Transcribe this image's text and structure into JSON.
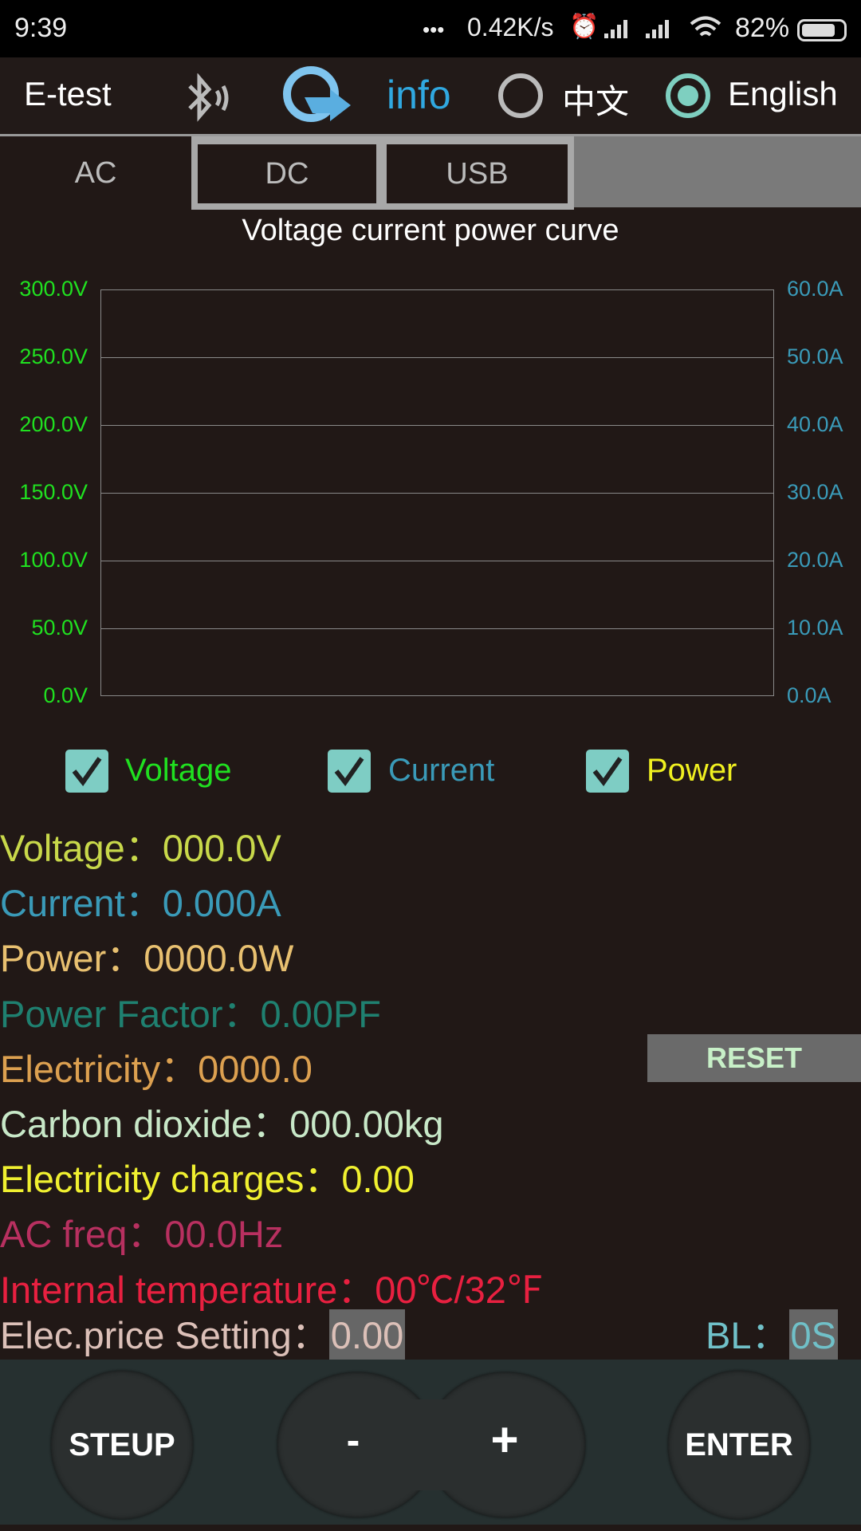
{
  "status_bar": {
    "time": "9:39",
    "dots": "•••",
    "net_speed": "0.42K/s",
    "battery": "82%"
  },
  "header": {
    "app_name": "E-test",
    "info_label": "info",
    "lang_chinese": "中文",
    "lang_english": "English",
    "selected_language": "English"
  },
  "tabs": [
    {
      "label": "AC",
      "active": true
    },
    {
      "label": "DC",
      "active": false
    },
    {
      "label": "USB",
      "active": false
    }
  ],
  "chart_data": {
    "type": "line",
    "title": "Voltage current power curve",
    "y_left": {
      "ticks": [
        "0.0V",
        "50.0V",
        "100.0V",
        "150.0V",
        "200.0V",
        "250.0V",
        "300.0V"
      ],
      "range": [
        0,
        300
      ],
      "color": "#20e020"
    },
    "y_right": {
      "ticks": [
        "0.0A",
        "10.0A",
        "20.0A",
        "30.0A",
        "40.0A",
        "50.0A",
        "60.0A"
      ],
      "range": [
        0,
        60
      ],
      "color": "#3a9ab8"
    },
    "grid": true,
    "series": []
  },
  "legend": [
    {
      "label": "Voltage",
      "checked": true,
      "color": "#20e020"
    },
    {
      "label": "Current",
      "checked": true,
      "color": "#3a9ab8"
    },
    {
      "label": "Power",
      "checked": true,
      "color": "#f0f020"
    }
  ],
  "readings": [
    {
      "label": "Voltage",
      "value": "000.0V",
      "color": "#c8d84a"
    },
    {
      "label": "Current",
      "value": "0.000A",
      "color": "#3a9ab8"
    },
    {
      "label": "Power",
      "value": "0000.0W",
      "color": "#e8c070"
    },
    {
      "label": "Power Factor",
      "value": "0.00PF",
      "color": "#1f8070"
    },
    {
      "label": "Electricity",
      "value": "0000.0",
      "color": "#dca050"
    },
    {
      "label": "Carbon dioxide",
      "value": "000.00kg",
      "color": "#c8e8c8"
    },
    {
      "label": "Electricity charges",
      "value": "0.00",
      "color": "#f0f030"
    },
    {
      "label": "AC freq",
      "value": "00.0Hz",
      "color": "#b83060"
    },
    {
      "label": "Internal temperature",
      "value": "00℃/32℉",
      "color": "#e82040"
    }
  ],
  "separator": "：",
  "reset_label": "RESET",
  "price": {
    "label": "Elec.price Setting",
    "value": "0.00",
    "color": "#dcc0b8"
  },
  "bl": {
    "label": "BL",
    "value": "0S",
    "color": "#70c0c8"
  },
  "buttons": {
    "setup": "STEUP",
    "minus": "-",
    "plus": "+",
    "enter": "ENTER"
  }
}
